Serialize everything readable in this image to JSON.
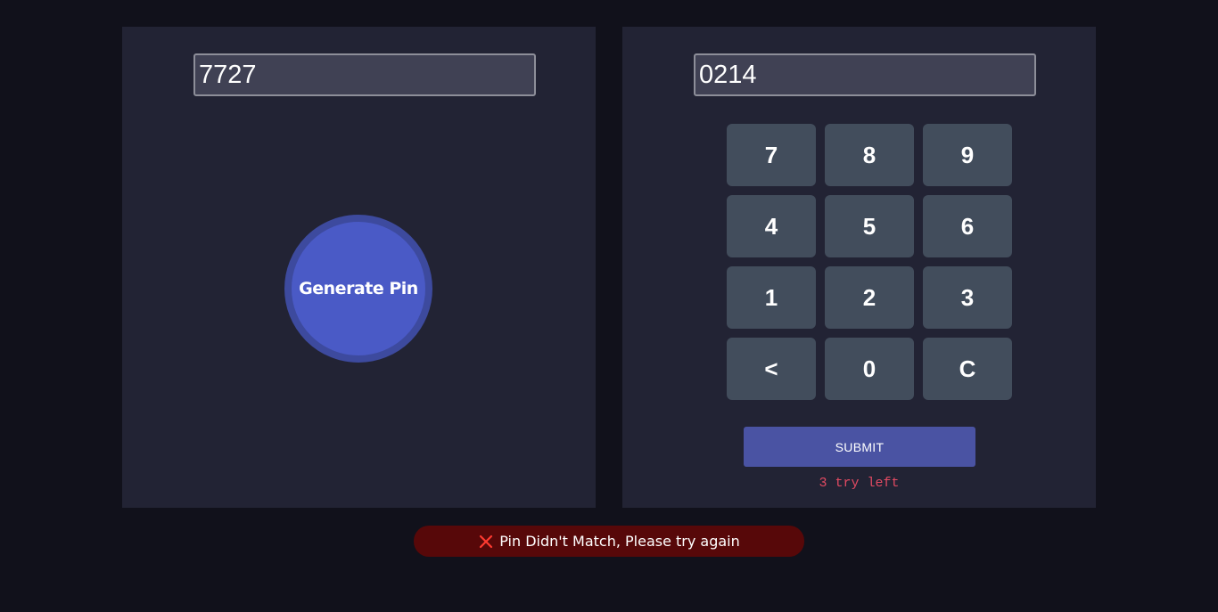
{
  "generator": {
    "pin_value": "7727",
    "button_label": "Generate Pin"
  },
  "entry": {
    "pin_value": "0214",
    "keys": [
      "7",
      "8",
      "9",
      "4",
      "5",
      "6",
      "1",
      "2",
      "3",
      "<",
      "0",
      "C"
    ],
    "key_names": [
      "key-7",
      "key-8",
      "key-9",
      "key-4",
      "key-5",
      "key-6",
      "key-1",
      "key-2",
      "key-3",
      "key-backspace",
      "key-0",
      "key-clear"
    ],
    "submit_label": "SUBMIT",
    "tries_text": "3 try left"
  },
  "notification": {
    "icon": "close-icon",
    "message": "Pin Didn't Match, Please try again",
    "icon_color": "#ff3b30"
  },
  "colors": {
    "background": "#11111b",
    "panel": "#222334",
    "accent": "#4a5ac6",
    "key": "#424d5c",
    "error": "#e24a62",
    "toast": "#570809"
  }
}
